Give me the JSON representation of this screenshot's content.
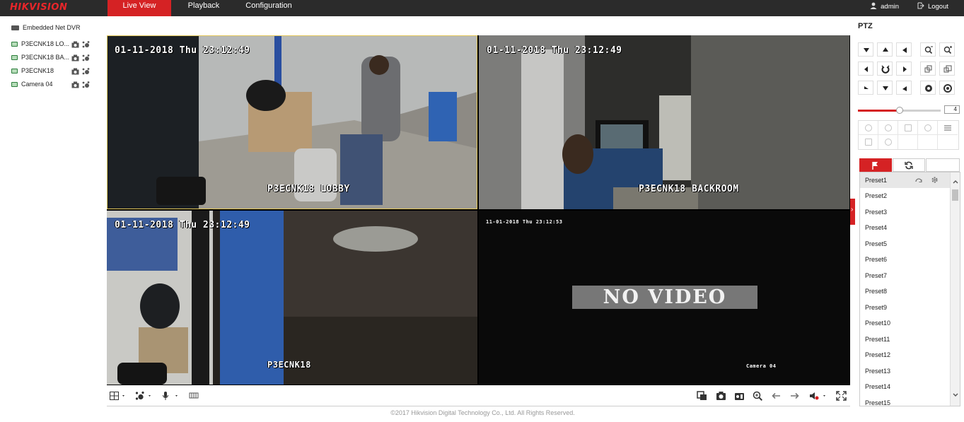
{
  "app": {
    "brand": "HIKVISION",
    "nav": [
      {
        "label": "Live View",
        "active": true
      },
      {
        "label": "Playback",
        "active": false
      },
      {
        "label": "Configuration",
        "active": false
      }
    ],
    "user": "admin",
    "logout": "Logout"
  },
  "tree": {
    "root": "Embedded Net DVR",
    "cameras": [
      {
        "label": "P3ECNK18 LO..."
      },
      {
        "label": "P3ECNK18 BA..."
      },
      {
        "label": "P3ECNK18"
      },
      {
        "label": "Camera 04"
      }
    ]
  },
  "video": {
    "panes": [
      {
        "timestamp": "01-11-2018 Thu 23:12:49",
        "name": "P3ECNK18 LOBBY",
        "selected": true
      },
      {
        "timestamp": "01-11-2018 Thu 23:12:49",
        "name": "P3ECNK18 BACKROOM"
      },
      {
        "timestamp": "01-11-2018 Thu 23:12:49",
        "name": "P3ECNK18"
      },
      {
        "timestamp": "11-01-2018 Thu 23:12:53",
        "name": "Camera 04",
        "overlay": "NO VIDEO"
      }
    ]
  },
  "ptz": {
    "title": "PTZ",
    "speed": "4",
    "speed_fraction": 0.5,
    "presets": [
      "Preset1",
      "Preset2",
      "Preset3",
      "Preset4",
      "Preset5",
      "Preset6",
      "Preset7",
      "Preset8",
      "Preset9",
      "Preset10",
      "Preset11",
      "Preset12",
      "Preset13",
      "Preset14",
      "Preset15"
    ]
  },
  "footer": "©2017 Hikvision Digital Technology Co., Ltd. All Rights Reserved.",
  "colors": {
    "accent": "#d52224",
    "topbar": "#2b2b2b",
    "selection": "#e4c85a"
  }
}
